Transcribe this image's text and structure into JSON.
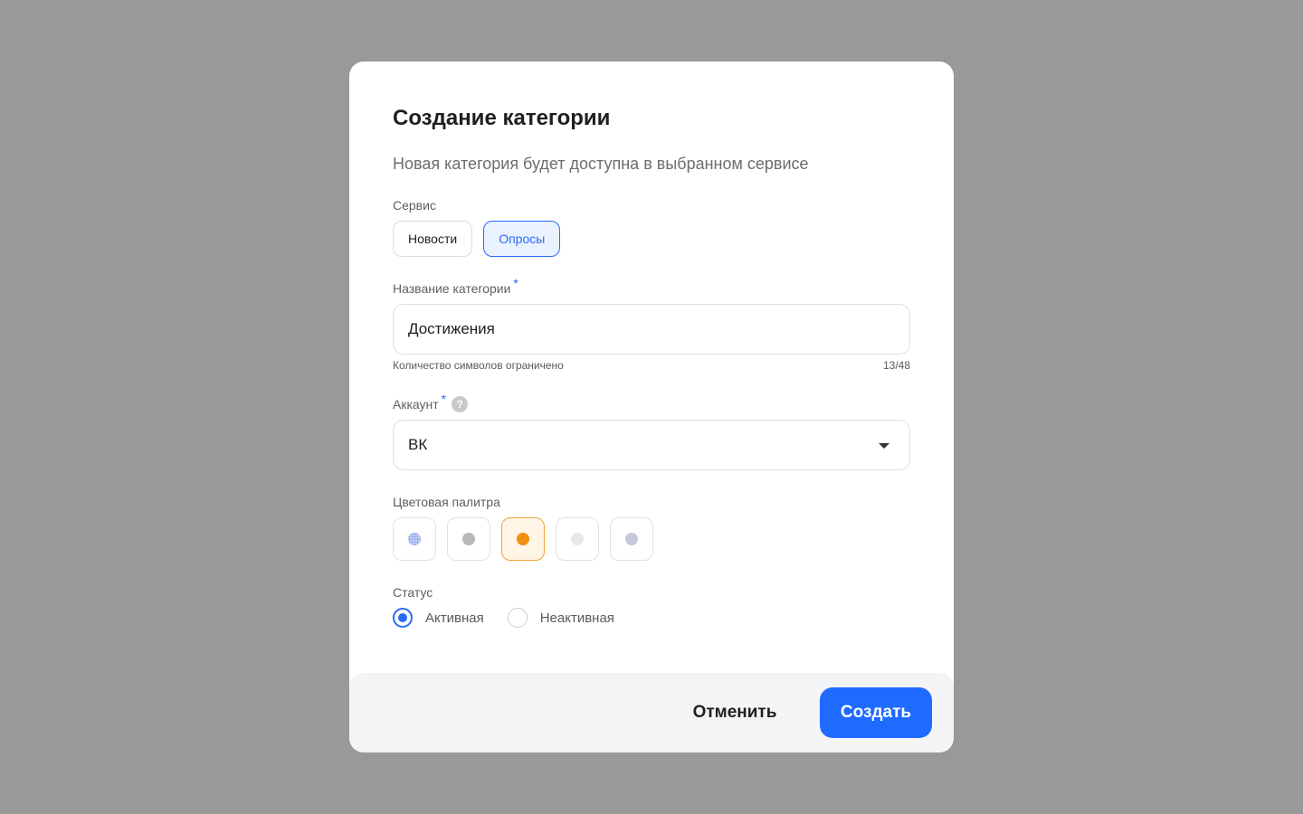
{
  "dialog": {
    "title": "Создание категории",
    "subtitle": "Новая категория будет доступна в выбранном сервисе"
  },
  "service": {
    "label": "Сервис",
    "options": [
      "Новости",
      "Опросы"
    ],
    "selected": "Опросы"
  },
  "category_name": {
    "label": "Название категории",
    "required_mark": "*",
    "value": "Достижения",
    "hint": "Количество символов ограничено",
    "counter": "13/48"
  },
  "account": {
    "label": "Аккаунт",
    "required_mark": "*",
    "help_icon": "?",
    "value": "ВК"
  },
  "palette": {
    "label": "Цветовая палитра",
    "swatches": [
      {
        "color": "#c7d3f5",
        "style": "pattern"
      },
      {
        "color": "#b8b9bb"
      },
      {
        "color": "#f0900f"
      },
      {
        "color": "#e6e7ea"
      },
      {
        "color": "#c5c9dd"
      }
    ],
    "selected_index": 2
  },
  "status": {
    "label": "Статус",
    "options": [
      "Активная",
      "Неактивная"
    ],
    "selected": "Активная"
  },
  "footer": {
    "cancel_label": "Отменить",
    "create_label": "Создать"
  },
  "colors": {
    "accent": "#1f6bff",
    "backdrop": "#999999"
  }
}
